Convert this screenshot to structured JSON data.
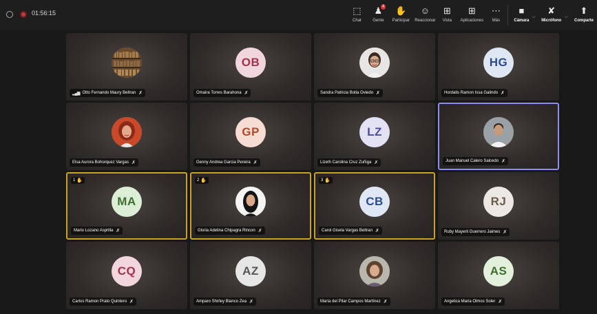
{
  "meeting": {
    "timer": "01:56:15"
  },
  "toolbar": {
    "chat": "Chat",
    "people": "Gente",
    "people_badge": "4",
    "participate": "Participar",
    "react": "Reaccionar",
    "view": "Vista",
    "apps": "Aplicaciones",
    "more": "Más",
    "camera": "Cámara",
    "mic": "Micrófono",
    "share": "Comparte"
  },
  "colors": {
    "raised_hand": "#c9a227",
    "active_speaker": "#8c8ff0",
    "recording": "#c23b3b"
  },
  "participants": [
    {
      "name": "Otto Fernando Maury Beltran",
      "initials": "",
      "photo": "bookshelf"
    },
    {
      "name": "Omaira Torres Barahona",
      "initials": "OB",
      "bg": "#f1d7dd",
      "fg": "#a8304a"
    },
    {
      "name": "Sandra Patricia Botia Oviedo",
      "initials": "",
      "photo": "woman-glasses"
    },
    {
      "name": "Hordalis Ramon Issa Galindo",
      "initials": "HG",
      "bg": "#dfe6f4",
      "fg": "#2d4a8f"
    },
    {
      "name": "Elsa Aurora Bohorquez Vargas",
      "initials": "",
      "photo": "woman-red"
    },
    {
      "name": "Genny Andrea Garcia Pereira",
      "initials": "GP",
      "bg": "#f6dcd3",
      "fg": "#b04a25"
    },
    {
      "name": "Lizeth Carolina Cruz Zuñiga",
      "initials": "LZ",
      "bg": "#e3e2f4",
      "fg": "#4b4c9d"
    },
    {
      "name": "Juan Manuel Calero Salcedo",
      "initials": "",
      "photo": "man"
    },
    {
      "name": "Mario Lozano Asprilla",
      "initials": "MA",
      "bg": "#dcefd6",
      "fg": "#3d6e30",
      "hand": "1"
    },
    {
      "name": "Gloria Adelina Chipagra Rincon",
      "initials": "",
      "photo": "woman-dark",
      "hand": "2"
    },
    {
      "name": "Carol Gisela Vargas Beltran",
      "initials": "CB",
      "bg": "#dfe6f4",
      "fg": "#2d4a8f",
      "hand": "3"
    },
    {
      "name": "Ruby Mayerli Guerrero Jaimes",
      "initials": "RJ",
      "bg": "#ece9e4",
      "fg": "#6b5b49"
    },
    {
      "name": "Carlos Ramon Prato Quintero",
      "initials": "CQ",
      "bg": "#f1d7dd",
      "fg": "#a8304a"
    },
    {
      "name": "Amparo Shirley Blanco Zea",
      "initials": "AZ",
      "bg": "#e6e6e6",
      "fg": "#555555"
    },
    {
      "name": "María del Pilar Campos Martínez",
      "initials": "",
      "photo": "woman-curly"
    },
    {
      "name": "Angelica Maria Olmos Soler",
      "initials": "AS",
      "bg": "#e2f0dc",
      "fg": "#3d6e30"
    }
  ]
}
